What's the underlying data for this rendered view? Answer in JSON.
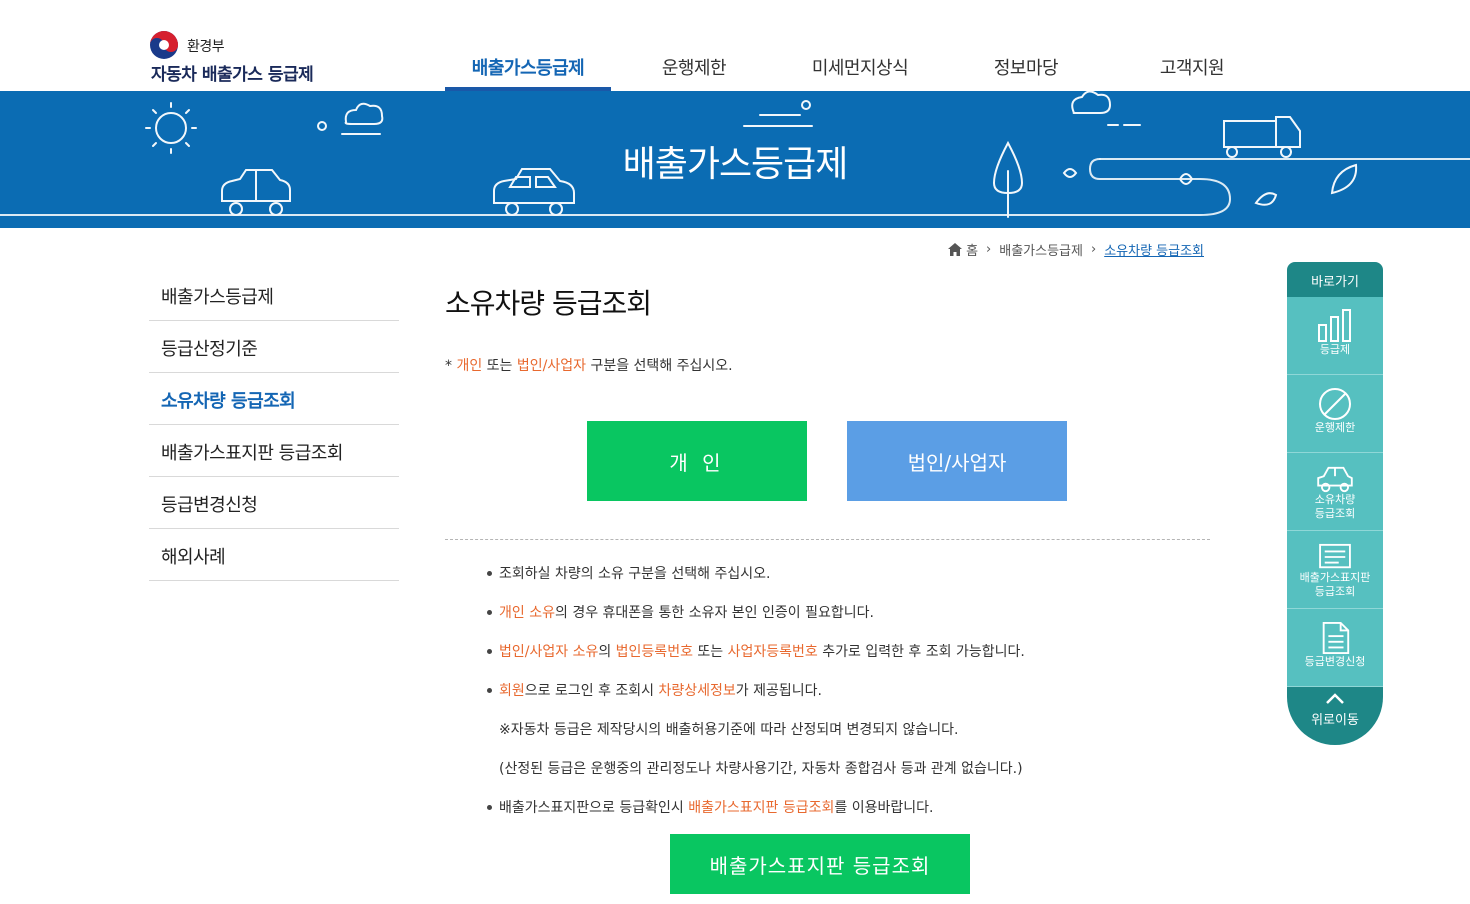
{
  "header": {
    "ministry": "환경부",
    "site_title": "자동차 배출가스 등급제",
    "nav": [
      "배출가스등급제",
      "운행제한",
      "미세먼지상식",
      "정보마당",
      "고객지원"
    ],
    "active_nav": 0
  },
  "banner": {
    "title": "배출가스등급제"
  },
  "breadcrumb": {
    "home": "홈",
    "level1": "배출가스등급제",
    "current": "소유차량 등급조회"
  },
  "lnb": {
    "items": [
      "배출가스등급제",
      "등급산정기준",
      "소유차량 등급조회",
      "배출가스표지판 등급조회",
      "등급변경신청",
      "해외사례"
    ],
    "active": 2
  },
  "content": {
    "title": "소유차량 등급조회",
    "notice": {
      "prefix": "* ",
      "hl1": "개인",
      "t1": " 또는 ",
      "hl2": "법인/사업자",
      "t2": " 구분을 선택해 주십시오."
    },
    "btn_personal": "개 인",
    "btn_corp": "법인/사업자",
    "info": {
      "line1": "조회하실 차량의 소유 구분을 선택해 주십시오.",
      "line2_hl": "개인 소유",
      "line2_rest": "의 경우 휴대폰을 통한 소유자 본인 인증이 필요합니다.",
      "line3_hl1": "법인/사업자 소유",
      "line3_t1": "의 ",
      "line3_hl2": "법인등록번호",
      "line3_t2": " 또는 ",
      "line3_hl3": "사업자등록번호",
      "line3_t3": " 추가로 입력한 후 조회 가능합니다.",
      "line4_hl1": "회원",
      "line4_t1": "으로 로그인 후 조회시 ",
      "line4_hl2": "차량상세정보",
      "line4_t2": "가 제공됩니다.",
      "line5": "※자동차 등급은 제작당시의 배출허용기준에 따라 산정되며 변경되지 않습니다.",
      "line6": "(산정된 등급은 운행중의 관리정도나 차량사용기간, 자동차 종합검사 등과 관계 없습니다.)",
      "line7_t1": "배출가스표지판으로 등급확인시 ",
      "line7_hl": "배출가스표지판 등급조회",
      "line7_t2": "를 이용바랍니다."
    },
    "btn_sign": "배출가스표지판 등급조회"
  },
  "quick": {
    "title": "바로가기",
    "items": [
      {
        "label": "등급제",
        "icon": "bar-chart-icon"
      },
      {
        "label": "운행제한",
        "icon": "prohibit-icon"
      },
      {
        "label": "소유차량\n등급조회",
        "icon": "car-icon"
      },
      {
        "label": "배출가스표지판\n등급조회",
        "icon": "sign-icon"
      },
      {
        "label": "등급변경신청",
        "icon": "document-icon"
      }
    ],
    "top": "위로이동"
  },
  "colors": {
    "primary_blue": "#0b6cb3",
    "nav_active": "#1466b4",
    "green": "#09c661",
    "light_blue": "#5b9ee5",
    "orange": "#e8692f",
    "teal": "#56c0c0",
    "teal_dark": "#1e8787"
  }
}
